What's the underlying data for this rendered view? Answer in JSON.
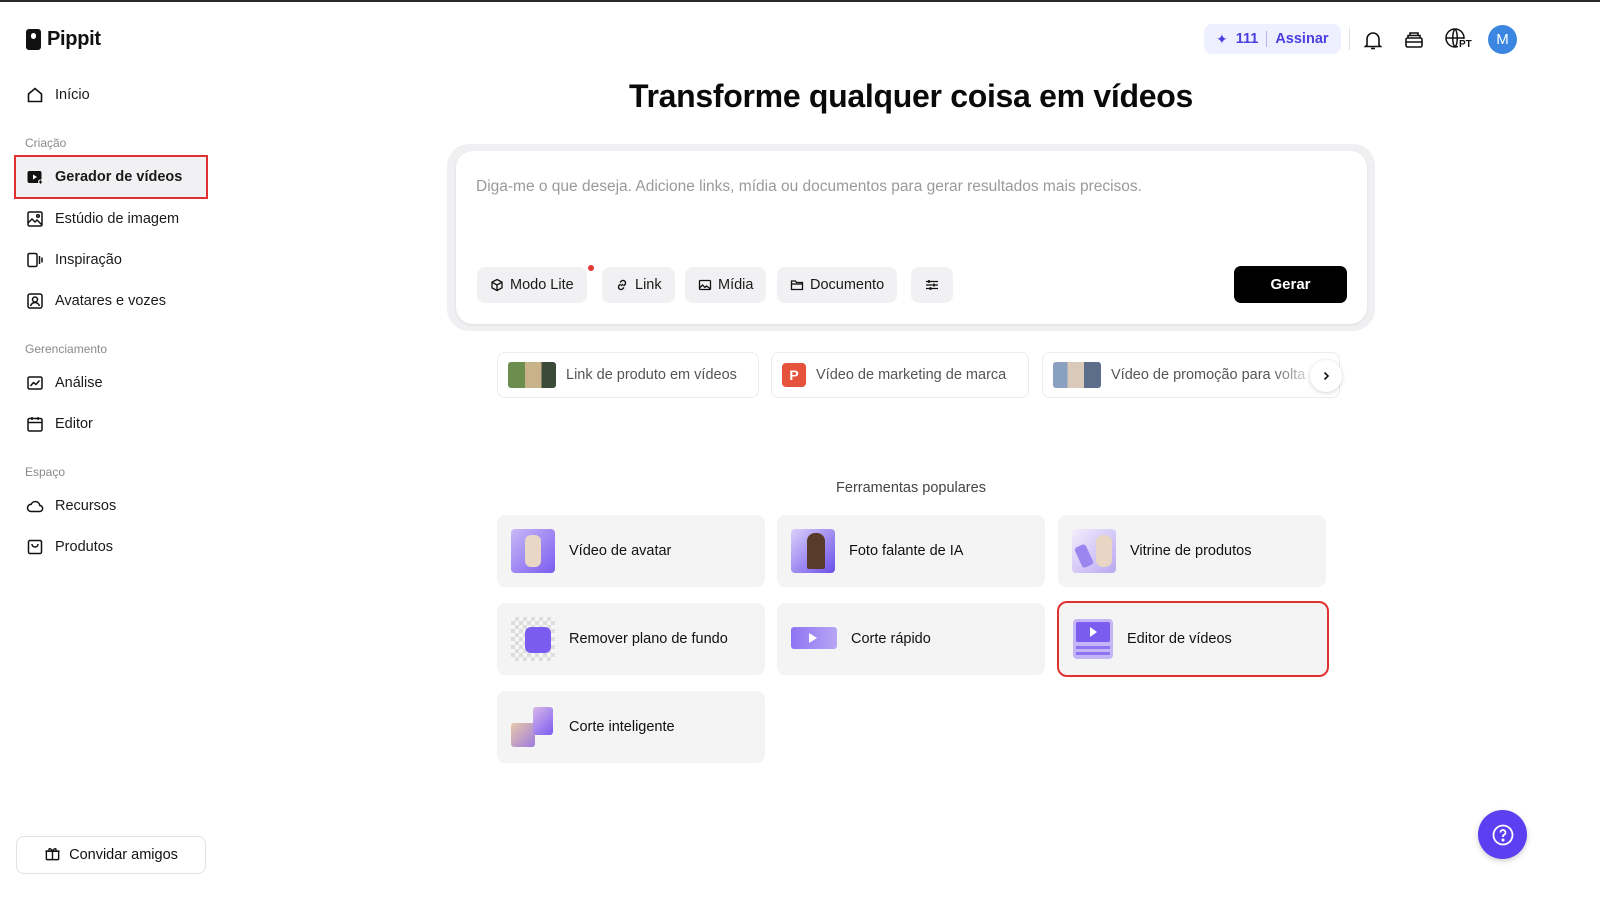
{
  "app": {
    "name": "Pippit"
  },
  "sidebar": {
    "home": "Início",
    "sections": [
      {
        "label": "Criação",
        "items": [
          "Gerador de vídeos",
          "Estúdio de imagem",
          "Inspiração",
          "Avatares e vozes"
        ]
      },
      {
        "label": "Gerenciamento",
        "items": [
          "Análise",
          "Editor"
        ]
      },
      {
        "label": "Espaço",
        "items": [
          "Recursos",
          "Produtos"
        ]
      }
    ],
    "active_item": "Gerador de vídeos",
    "invite_label": "Convidar amigos"
  },
  "header": {
    "credits": "111",
    "subscribe_label": "Assinar",
    "language_badge": "PT",
    "avatar_initial": "M",
    "icons": [
      "bell-icon",
      "stack-icon",
      "globe-icon"
    ]
  },
  "main": {
    "title": "Transforme qualquer coisa em vídeos",
    "prompt": {
      "placeholder": "Diga-me o que deseja. Adicione links, mídia ou documentos para gerar resultados mais precisos.",
      "chips": [
        "Modo Lite",
        "Link",
        "Mídia",
        "Documento"
      ],
      "generate_label": "Gerar"
    },
    "suggestions": [
      "Link de produto em vídeos",
      "Vídeo de marketing de marca",
      "Vídeo de promoção para volta"
    ],
    "suggestion_badge": "P",
    "popular_tools_title": "Ferramentas populares",
    "tools": [
      "Vídeo de avatar",
      "Foto falante de IA",
      "Vitrine de produtos",
      "Remover plano de fundo",
      "Corte rápido",
      "Editor de vídeos",
      "Corte inteligente"
    ],
    "selected_tool": "Editor de vídeos"
  },
  "colors": {
    "accent": "#5b3ff0",
    "highlight_outline": "#e03131",
    "credits_text": "#4b3fe0",
    "avatar_bg": "#3b86e0"
  }
}
